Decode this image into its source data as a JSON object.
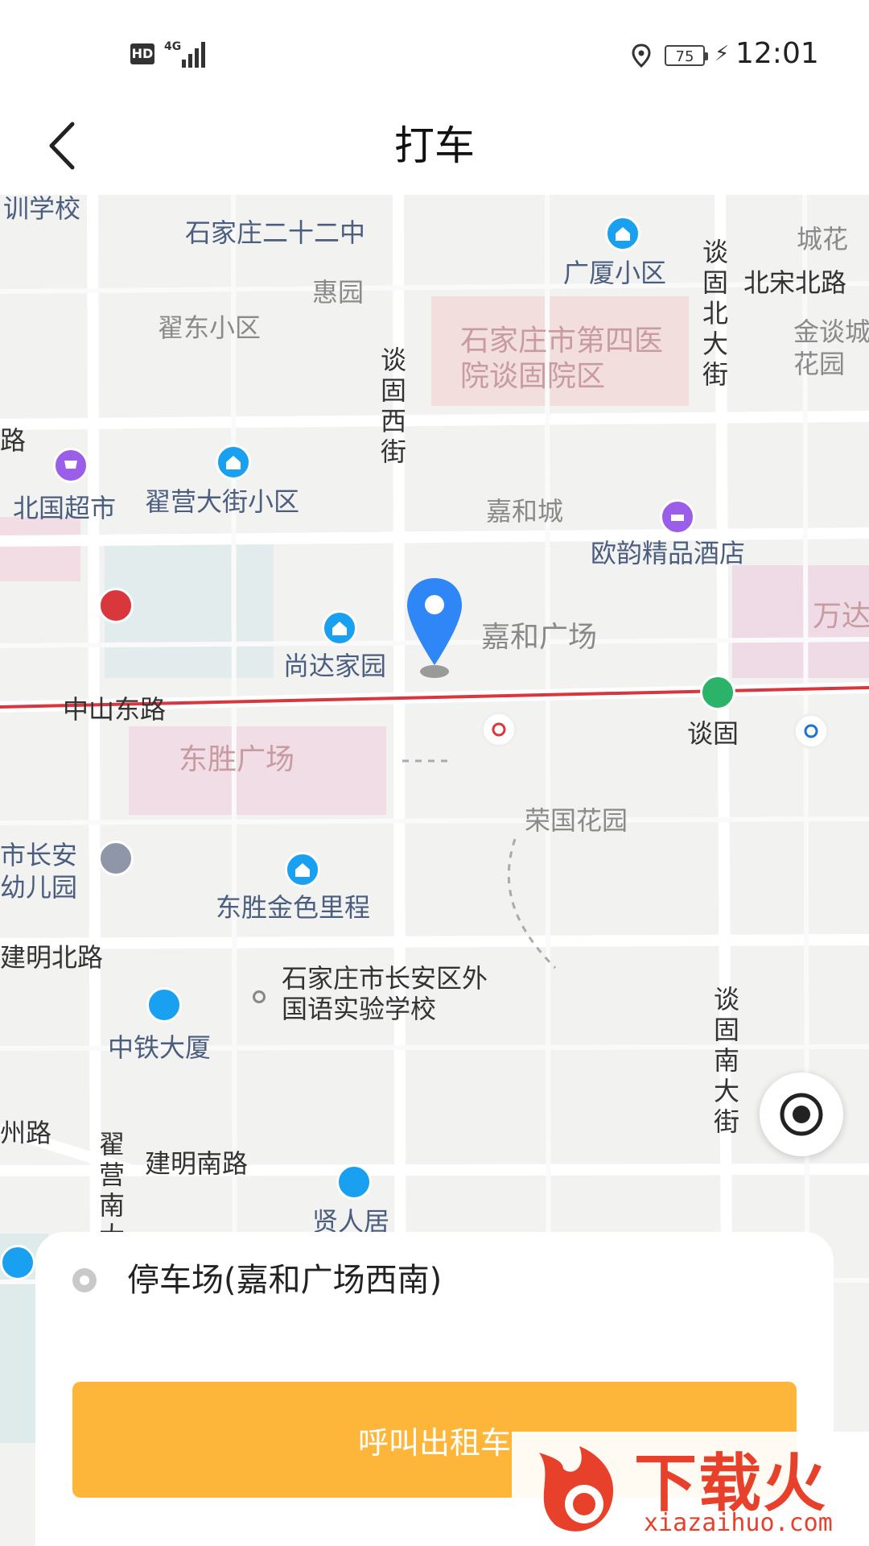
{
  "status_bar": {
    "hd": "HD",
    "network": "4G",
    "battery": "75",
    "time": "12:01"
  },
  "header": {
    "title": "打车",
    "back_icon": "chevron-left-icon"
  },
  "map": {
    "labels": {
      "training_school": "训学校",
      "school_22": "石家庄二十二中",
      "guangsha": "广厦小区",
      "chenghua_top": "城花",
      "huiyuan": "惠园",
      "beisongbei": "北宋北路",
      "didong": "翟东小区",
      "hospital": "石家庄市第四医院谈固院区",
      "jintan": "金谈城花园",
      "road_fragment": "路",
      "beiguo": "北国超市",
      "diying": "翟营大街小区",
      "jiahecheng": "嘉和城",
      "ouyun": "欧韵精品酒店",
      "shangda": "尚达家园",
      "jiahe_plaza": "嘉和广场",
      "wanda": "万达",
      "zhongshan_east": "中山东路",
      "tangu_station": "谈固",
      "dongsheng_plaza": "东胜广场",
      "rongguo": "荣国花园",
      "changan_kg": "市长安幼儿园",
      "dongsheng_jinse": "东胜金色里程",
      "jianming_north": "建明北路",
      "foreign_school": "石家庄市长安区外国语实验学校",
      "zhongtie": "中铁大厦",
      "road_fragment2": "州路",
      "jianming_south": "建明南路",
      "xianren": "贤人居"
    },
    "vertical_labels": {
      "tangu_west": "谈固西街",
      "tangu_north": "谈固北大街",
      "tangu_south": "谈固南大街",
      "diying_south": "翟营南大"
    }
  },
  "origin": {
    "address": "停车场(嘉和广场西南)"
  },
  "call_button": {
    "label": "呼叫出租车"
  },
  "watermark": {
    "brand": "下载火",
    "domain": "xiazaihuo.com"
  },
  "colors": {
    "accent": "#fdb63a",
    "pin": "#2f86f6",
    "subway_line": "#d9363e",
    "poi_blue": "#1aa0f0"
  }
}
